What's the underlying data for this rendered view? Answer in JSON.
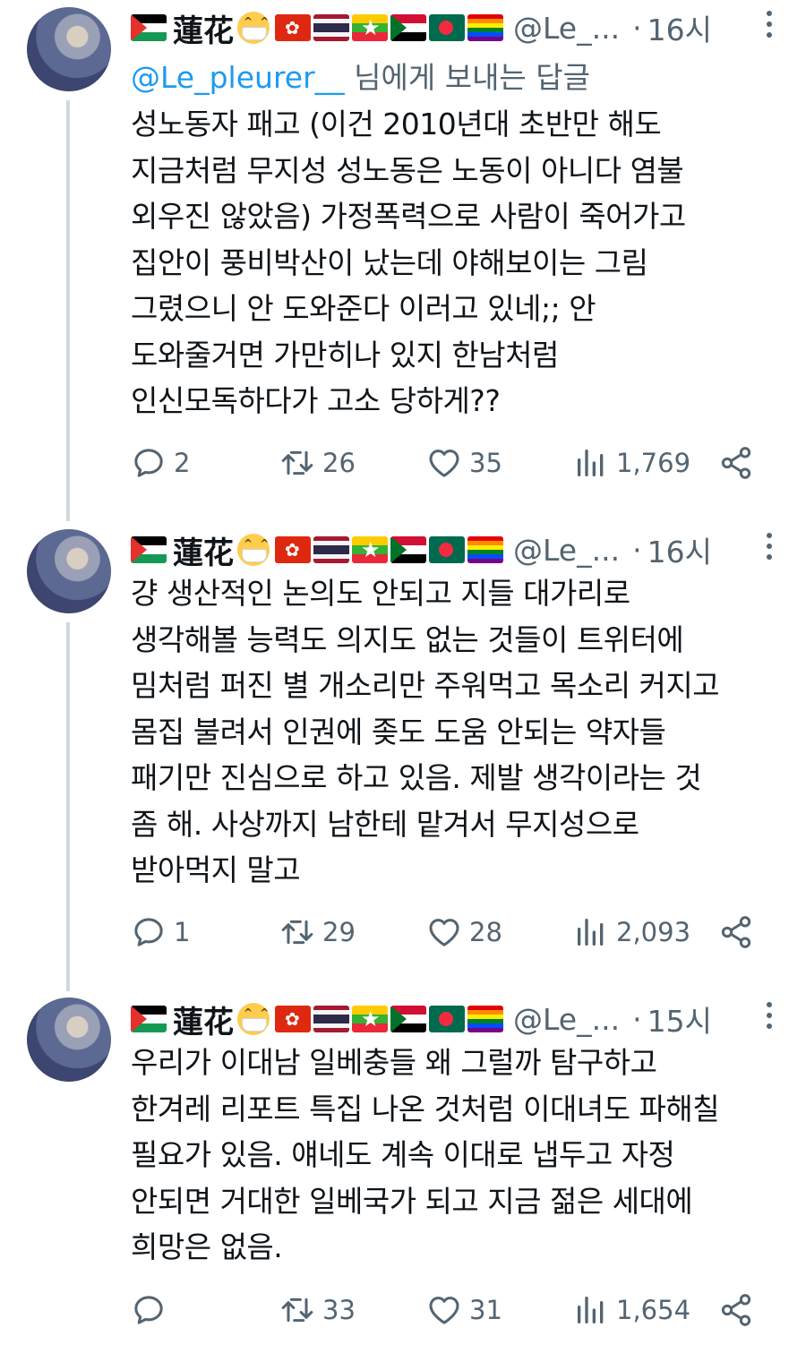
{
  "tweets": [
    {
      "display_name": "蓮花",
      "handle": "@Le_...",
      "time": "16시",
      "reply_prefix_mention": "@Le_pleurer__",
      "reply_suffix": " 님에게 보내는 답글",
      "lines": [
        "성노동자 패고 (이건 2010년대 초반만 해도",
        "지금처럼 무지성 성노동은 노동이 아니다 염불",
        "외우진 않았음) 가정폭력으로 사람이 죽어가고",
        "집안이 풍비박산이 났는데 야해보이는 그림",
        "그렸으니 안 도와준다 이러고 있네;; 안",
        "도와줄거면 가만히나 있지 한남처럼",
        "인신모독하다가 고소 당하게??"
      ],
      "replies": "2",
      "retweets": "26",
      "likes": "35",
      "views": "1,769"
    },
    {
      "display_name": "蓮花",
      "handle": "@Le_...",
      "time": "16시",
      "lines": [
        "걍 생산적인 논의도 안되고 지들 대가리로",
        "생각해볼 능력도 의지도 없는 것들이 트위터에",
        "밈처럼 퍼진 별 개소리만 주워먹고 목소리 커지고",
        "몸집 불려서 인권에 좆도 도움 안되는 약자들",
        "패기만 진심으로 하고 있음. 제발 생각이라는 것",
        "좀 해. 사상까지 남한테 맡겨서 무지성으로",
        "받아먹지 말고"
      ],
      "replies": "1",
      "retweets": "29",
      "likes": "28",
      "views": "2,093"
    },
    {
      "display_name": "蓮花",
      "handle": "@Le_...",
      "time": "15시",
      "lines": [
        "우리가 이대남 일베충들 왜 그럴까 탐구하고",
        "한겨레 리포트 특집 나온 것처럼 이대녀도 파해칠",
        "필요가 있음. 얘네도 계속 이대로 냅두고 자정",
        "안되면 거대한 일베국가 되고 지금 젊은 세대에",
        "희망은 없음."
      ],
      "replies": "",
      "retweets": "33",
      "likes": "31",
      "views": "1,654"
    }
  ],
  "separator": "·",
  "icons": [
    "reply-icon",
    "retweet-icon",
    "like-icon",
    "views-icon",
    "share-icon",
    "more-icon",
    "avatar"
  ],
  "colors": {
    "text": "#0f1419",
    "secondary": "#536471",
    "link": "#1d9bf0",
    "thread_line": "#cfd9de"
  }
}
